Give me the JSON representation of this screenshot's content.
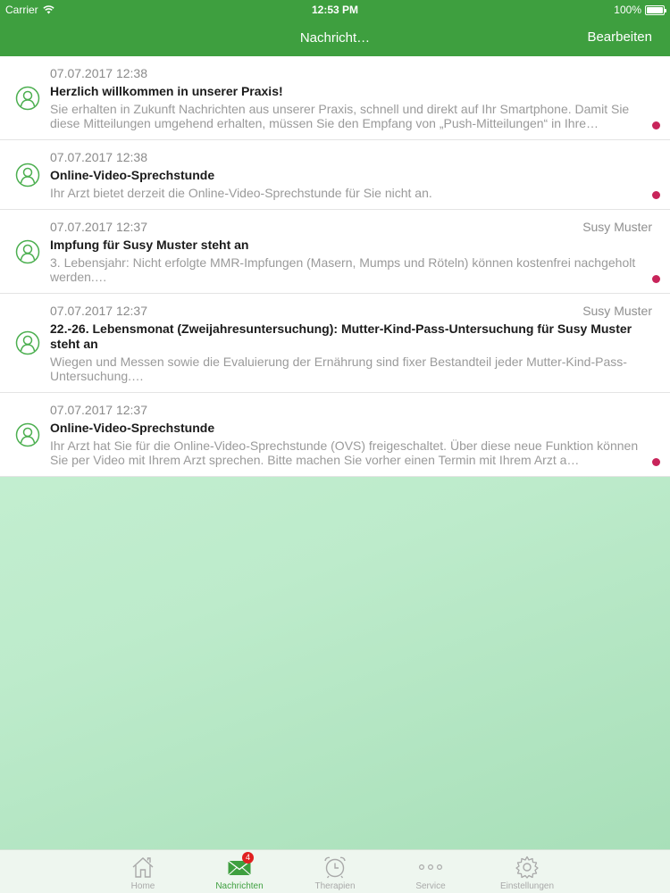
{
  "status_bar": {
    "carrier": "Carrier",
    "time": "12:53 PM",
    "battery": "100%"
  },
  "nav": {
    "title": "Nachricht…",
    "edit_label": "Bearbeiten"
  },
  "messages": [
    {
      "date": "07.07.2017 12:38",
      "sender": "",
      "title": "Herzlich willkommen in unserer Praxis!",
      "preview": "Sie erhalten in Zukunft Nachrichten aus unserer Praxis, schnell und direkt auf Ihr Smartphone. Damit Sie diese Mitteilungen umgehend erhalten, müssen Sie den Empfang von „Push-Mitteilungen“ in Ihre…",
      "unread": true
    },
    {
      "date": "07.07.2017 12:38",
      "sender": "",
      "title": "Online-Video-Sprechstunde",
      "preview": "Ihr Arzt bietet derzeit die Online-Video-Sprechstunde für Sie nicht an.",
      "unread": true
    },
    {
      "date": "07.07.2017 12:37",
      "sender": "Susy Muster",
      "title": "Impfung für Susy Muster steht an",
      "preview": "3. Lebensjahr: Nicht erfolgte MMR-Impfungen (Masern, Mumps und Röteln) können kostenfrei nachgeholt werden.…",
      "unread": true
    },
    {
      "date": "07.07.2017 12:37",
      "sender": "Susy Muster",
      "title": "22.-26. Lebensmonat  (Zweijahresuntersuchung): Mutter-Kind-Pass-Untersuchung für Susy Muster steht an",
      "preview": "Wiegen und Messen sowie die Evaluierung der Ernährung sind fixer Bestandteil jeder Mutter-Kind-Pass-Untersuchung.…",
      "unread": false
    },
    {
      "date": "07.07.2017 12:37",
      "sender": "",
      "title": "Online-Video-Sprechstunde",
      "preview": "Ihr Arzt hat Sie für die Online-Video-Sprechstunde (OVS) freigeschaltet. Über diese neue Funktion können Sie per Video mit Ihrem Arzt sprechen. Bitte machen Sie vorher einen Termin mit Ihrem Arzt a…",
      "unread": true
    }
  ],
  "tabs": [
    {
      "label": "Home",
      "icon": "home-icon"
    },
    {
      "label": "Nachrichten",
      "icon": "envelope-icon",
      "badge": "4"
    },
    {
      "label": "Therapien",
      "icon": "alarm-clock-icon"
    },
    {
      "label": "Service",
      "icon": "more-dots-icon"
    },
    {
      "label": "Einstellungen",
      "icon": "gear-icon"
    }
  ],
  "colors": {
    "brand_green": "#3e9f3f",
    "unread_dot": "#c8245a",
    "badge_red": "#e02020"
  }
}
